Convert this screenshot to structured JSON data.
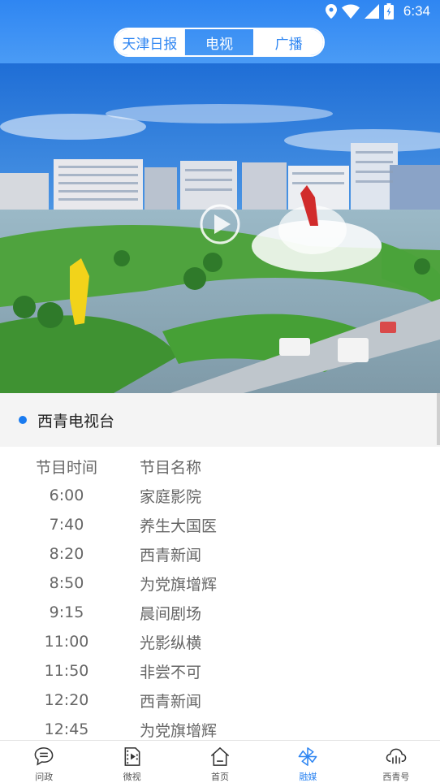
{
  "status_bar": {
    "time": "6:34",
    "icons": [
      "location-icon",
      "wifi-icon",
      "signal-icon",
      "battery-icon"
    ]
  },
  "tabs": [
    {
      "label": "天津日报",
      "style": "white"
    },
    {
      "label": "电视",
      "style": "active"
    },
    {
      "label": "广播",
      "style": "white"
    }
  ],
  "station": {
    "name": "西青电视台"
  },
  "schedule": {
    "header": {
      "time": "节目时间",
      "name": "节目名称"
    },
    "rows": [
      {
        "time": "6:00",
        "name": "家庭影院"
      },
      {
        "time": "7:40",
        "name": "养生大国医"
      },
      {
        "time": "8:20",
        "name": "西青新闻"
      },
      {
        "time": "8:50",
        "name": "为党旗增辉"
      },
      {
        "time": "9:15",
        "name": "晨间剧场"
      },
      {
        "time": "11:00",
        "name": "光影纵横"
      },
      {
        "time": "11:50",
        "name": "非尝不可"
      },
      {
        "time": "12:20",
        "name": "西青新闻"
      },
      {
        "time": "12:45",
        "name": "为党旗增辉"
      }
    ]
  },
  "bottom_nav": [
    {
      "label": "问政",
      "icon": "chat-bubble-icon"
    },
    {
      "label": "微视",
      "icon": "video-file-icon"
    },
    {
      "label": "首页",
      "icon": "home-icon"
    },
    {
      "label": "融媒",
      "icon": "pinwheel-icon",
      "active": true
    },
    {
      "label": "西青号",
      "icon": "cloud-icon"
    }
  ],
  "colors": {
    "accent": "#2f86f2",
    "station_dot": "#1a7bf0",
    "text_muted": "#666666"
  }
}
